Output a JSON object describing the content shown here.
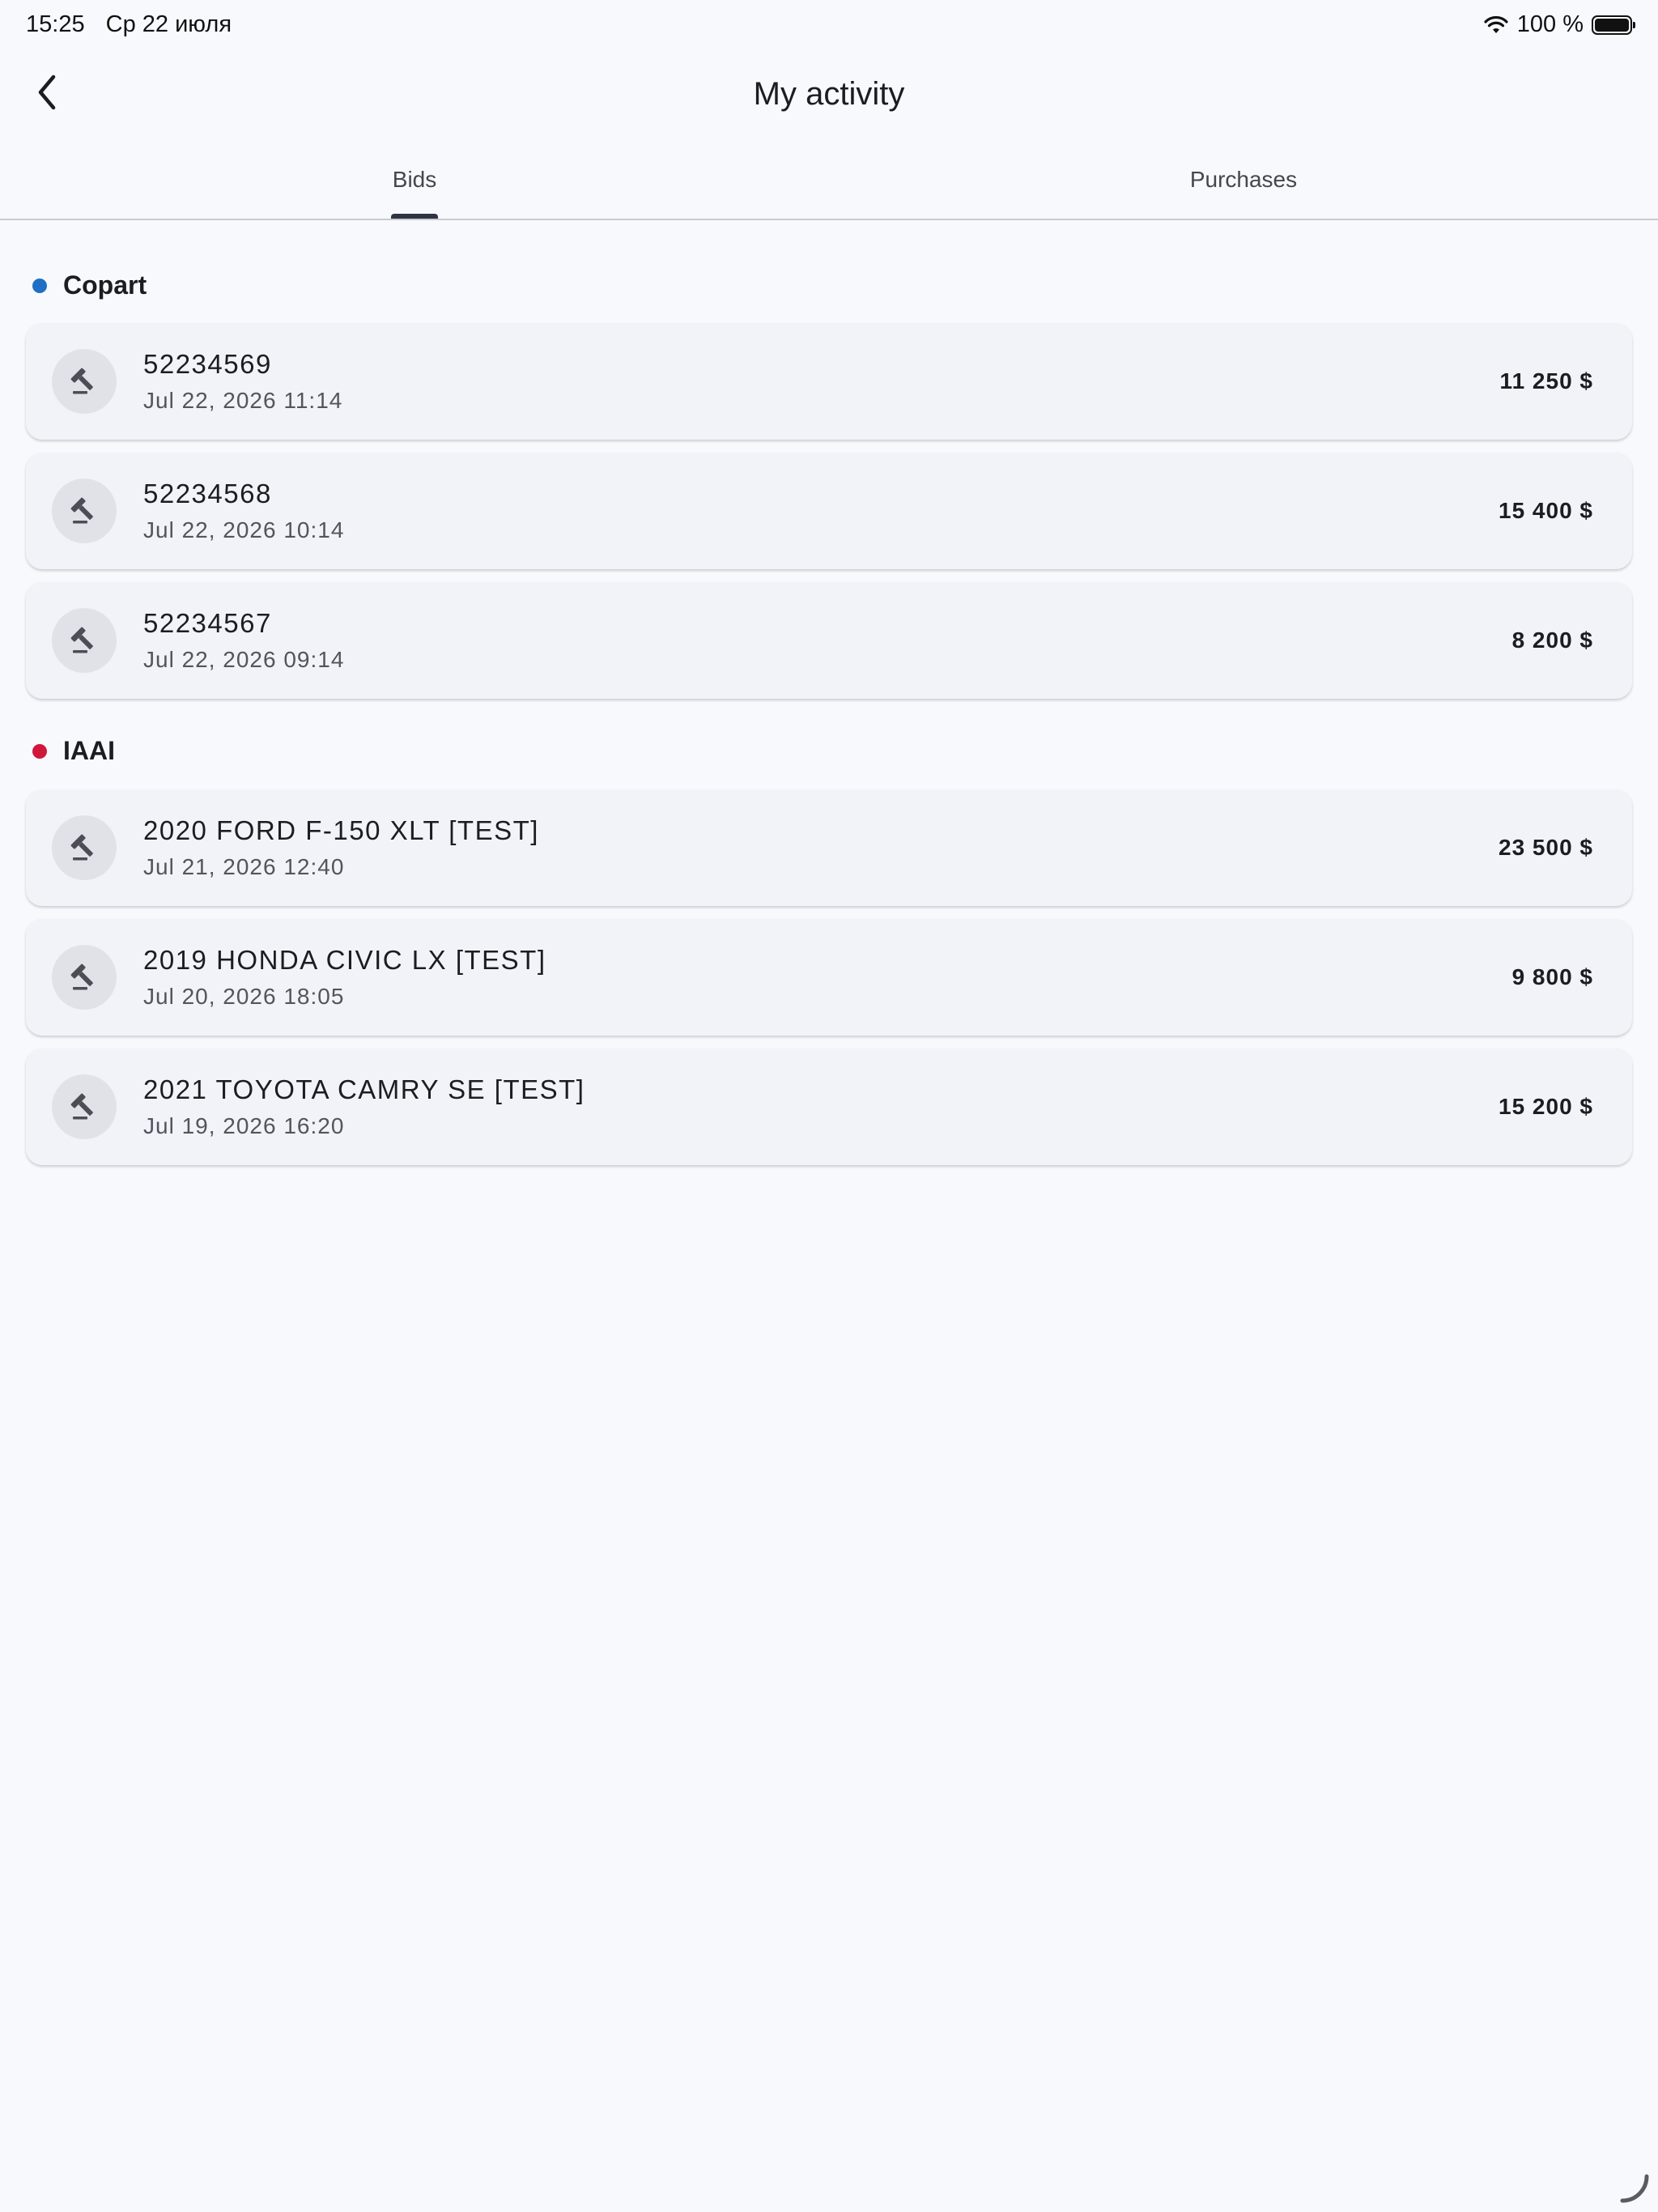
{
  "status_bar": {
    "time": "15:25",
    "date": "Ср 22 июля",
    "battery": "100 %",
    "battery_level": 1.0
  },
  "header": {
    "title": "My activity"
  },
  "tabs": [
    {
      "label": "Bids",
      "active": true
    },
    {
      "label": "Purchases",
      "active": false
    }
  ],
  "sections": [
    {
      "name": "Copart",
      "color": "#1f6fc5",
      "items": [
        {
          "title": "52234569",
          "date": "Jul 22, 2026 11:14",
          "amount": "11 250 $"
        },
        {
          "title": "52234568",
          "date": "Jul 22, 2026 10:14",
          "amount": "15 400 $"
        },
        {
          "title": "52234567",
          "date": "Jul 22, 2026 09:14",
          "amount": "8 200 $"
        }
      ]
    },
    {
      "name": "IAAI",
      "color": "#d0173b",
      "items": [
        {
          "title": "2020 FORD F-150 XLT [TEST]",
          "date": "Jul 21, 2026 12:40",
          "amount": "23 500 $"
        },
        {
          "title": "2019 HONDA CIVIC LX [TEST]",
          "date": "Jul 20, 2026 18:05",
          "amount": "9 800 $"
        },
        {
          "title": "2021 TOYOTA CAMRY SE [TEST]",
          "date": "Jul 19, 2026 16:20",
          "amount": "15 200 $"
        }
      ]
    }
  ],
  "icons": {
    "back": "chevron-left-icon",
    "item": "gavel-icon",
    "wifi": "wifi-icon",
    "battery": "battery-icon"
  }
}
